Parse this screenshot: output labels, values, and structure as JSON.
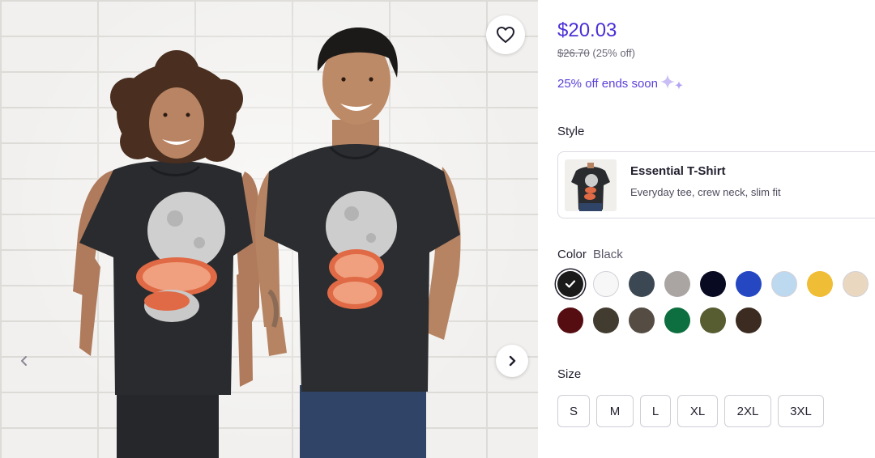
{
  "gallery": {
    "favorite_icon": "heart-outline-icon",
    "prev_icon": "chevron-left-icon",
    "next_icon": "chevron-right-icon"
  },
  "pricing": {
    "price": "$20.03",
    "original_price": "$26.70",
    "discount": "(25% off)",
    "sale_text": "25% off ends soon",
    "sale_icon": "sparkle-icon",
    "accent_color": "#4a2fd6"
  },
  "style": {
    "label": "Style",
    "selected_name": "Essential T-Shirt",
    "selected_description": "Everyday tee, crew neck, slim fit"
  },
  "color": {
    "label": "Color",
    "selected": "Black",
    "swatches": [
      {
        "hex": "#1a1a1a",
        "selected": true
      },
      {
        "hex": "#f7f7f7",
        "selected": false
      },
      {
        "hex": "#3b4753",
        "selected": false
      },
      {
        "hex": "#aaa5a2",
        "selected": false
      },
      {
        "hex": "#080a22",
        "selected": false
      },
      {
        "hex": "#2547c2",
        "selected": false
      },
      {
        "hex": "#bcd9ef",
        "selected": false
      },
      {
        "hex": "#f0bd37",
        "selected": false
      },
      {
        "hex": "#ead7c0",
        "selected": false
      },
      {
        "hex": "#560d12",
        "selected": false
      },
      {
        "hex": "#423b30",
        "selected": false
      },
      {
        "hex": "#554c43",
        "selected": false
      },
      {
        "hex": "#0d6f3f",
        "selected": false
      },
      {
        "hex": "#585c31",
        "selected": false
      },
      {
        "hex": "#3c2b20",
        "selected": false
      }
    ]
  },
  "size": {
    "label": "Size",
    "options": [
      "S",
      "M",
      "L",
      "XL",
      "2XL",
      "3XL"
    ]
  }
}
